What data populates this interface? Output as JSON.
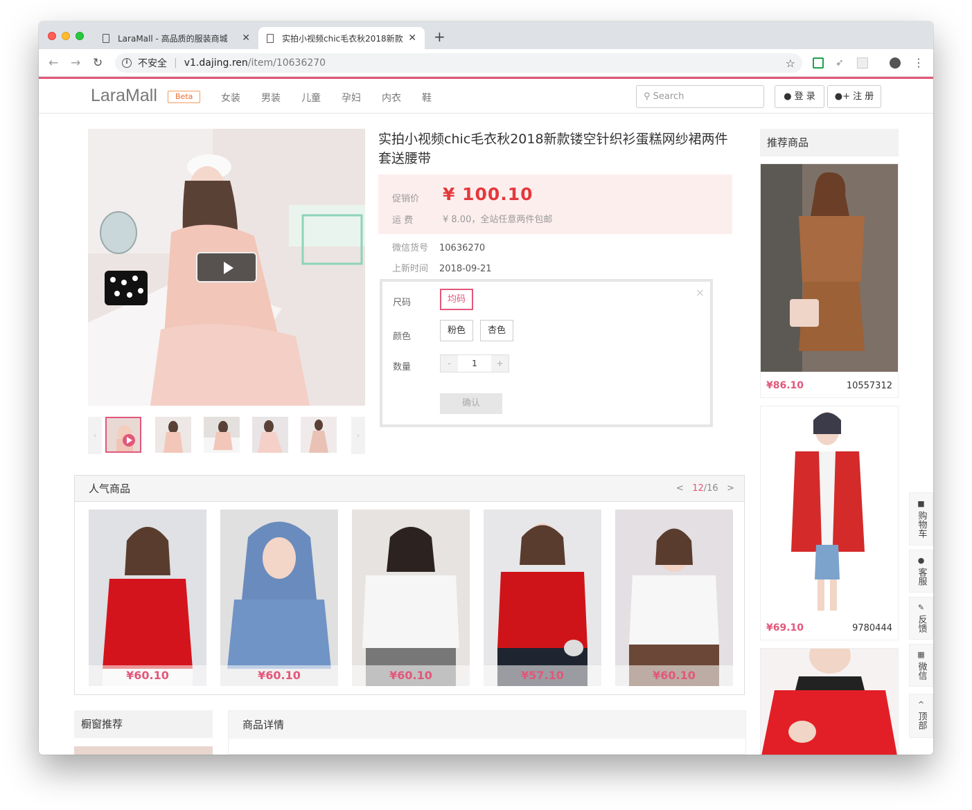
{
  "browser": {
    "tabs": [
      {
        "title": "LaraMall - 高品质的服装商城"
      },
      {
        "title": "实拍小视频chic毛衣秋2018新款"
      }
    ],
    "new_tab": "+",
    "address": {
      "security": "不安全",
      "host": "v1.dajing.ren",
      "path": "/item/10636270"
    }
  },
  "nav": {
    "brand": "LaraMall",
    "badge": "Beta",
    "links": [
      "女装",
      "男装",
      "儿童",
      "孕妇",
      "内衣",
      "鞋"
    ],
    "search_placeholder": "Search",
    "login": "登 录",
    "register": "注 册"
  },
  "product": {
    "title": "实拍小视频chic毛衣秋2018新款镂空针织衫蛋糕网纱裙两件套送腰带",
    "price_label": "促销价",
    "price": "¥ 100.10",
    "shipping_label": "运 费",
    "shipping": "¥ 8.00，全站任意两件包邮",
    "wechat_id_label": "微信货号",
    "wechat_id": "10636270",
    "listed_label": "上新时间",
    "listed": "2018-09-21"
  },
  "sku": {
    "size_label": "尺码",
    "sizes": [
      "均码"
    ],
    "color_label": "颜色",
    "colors": [
      "粉色",
      "杏色"
    ],
    "qty_label": "数量",
    "qty_minus": "-",
    "qty": "1",
    "qty_plus": "+",
    "confirm": "确认",
    "close": "×"
  },
  "recommend": {
    "heading": "推荐商品",
    "items": [
      {
        "price": "¥86.10",
        "sku": "10557312"
      },
      {
        "price": "¥69.10",
        "sku": "9780444"
      }
    ]
  },
  "popular": {
    "heading": "人气商品",
    "prev": "<",
    "page": "12",
    "total": "/16",
    "next": ">",
    "prices": [
      "¥60.10",
      "¥60.10",
      "¥60.10",
      "¥57.10",
      "¥60.10"
    ]
  },
  "window": {
    "heading": "橱窗推荐"
  },
  "details": {
    "heading": "商品详情"
  },
  "side_tools": [
    {
      "label": "购物车",
      "icon": "cart-icon"
    },
    {
      "label": "客服",
      "icon": "chat-icon"
    },
    {
      "label": "反馈",
      "icon": "edit-icon"
    },
    {
      "label": "微信",
      "icon": "qrcode-icon"
    },
    {
      "label": "顶部",
      "icon": "chevron-up-icon"
    }
  ],
  "colors": {
    "accent": "#e2577a",
    "price_red": "#e4393c",
    "beta_orange": "#ef6a2c"
  }
}
